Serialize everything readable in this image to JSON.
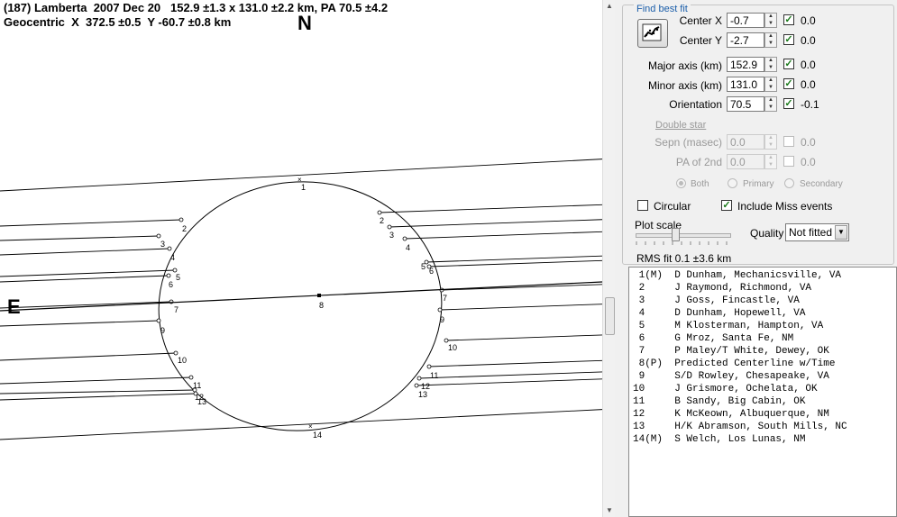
{
  "header": {
    "line1": "(187) Lamberta  2007 Dec 20   152.9 ±1.3 x 131.0 ±2.2 km, PA 70.5 ±4.2",
    "line2": "Geocentric  X  372.5 ±0.5  Y -60.7 ±0.8 km"
  },
  "compass": {
    "north": "N",
    "east": "E"
  },
  "chords": [
    {
      "label": "1"
    },
    {
      "label": "2"
    },
    {
      "label": "3"
    },
    {
      "label": "4"
    },
    {
      "label": "5"
    },
    {
      "label": "6"
    },
    {
      "label": "7"
    },
    {
      "label": "8"
    },
    {
      "label": "9"
    },
    {
      "label": "10"
    },
    {
      "label": "11"
    },
    {
      "label": "12"
    },
    {
      "label": "13"
    },
    {
      "label": "14"
    }
  ],
  "panel": {
    "group_title": "Find best fit",
    "fit_button_icon": "chart-fit-icon",
    "params": [
      {
        "label": "Center X",
        "value": "-0.7",
        "checked": true,
        "result": "0.0"
      },
      {
        "label": "Center Y",
        "value": "-2.7",
        "checked": true,
        "result": "0.0"
      },
      {
        "label": "Major axis (km)",
        "value": "152.9",
        "checked": true,
        "result": "0.0"
      },
      {
        "label": "Minor axis (km)",
        "value": "131.0",
        "checked": true,
        "result": "0.0"
      },
      {
        "label": "Orientation",
        "value": "70.5",
        "checked": true,
        "result": "-0.1"
      }
    ],
    "double_star": "Double star",
    "double_params": [
      {
        "label": "Sepn (masec)",
        "value": "0.0",
        "checked": false,
        "result": "0.0"
      },
      {
        "label": "PA of 2nd",
        "value": "0.0",
        "checked": false,
        "result": "0.0"
      }
    ],
    "radios": [
      "Both",
      "Primary",
      "Secondary"
    ],
    "circular": {
      "label": "Circular",
      "checked": false
    },
    "include_miss": {
      "label": "Include Miss events",
      "checked": true
    },
    "plot_scale": "Plot scale",
    "quality_label": "Quality",
    "quality_value": "Not fitted",
    "rms": "RMS fit 0.1 ±3.6 km"
  },
  "observers": [
    " 1(M)  D Dunham, Mechanicsville, VA",
    " 2     J Raymond, Richmond, VA",
    " 3     J Goss, Fincastle, VA",
    " 4     D Dunham, Hopewell, VA",
    " 5     M Klosterman, Hampton, VA",
    " 6     G Mroz, Santa Fe, NM",
    " 7     P Maley/T White, Dewey, OK",
    " 8(P)  Predicted Centerline w/Time",
    " 9     S/D Rowley, Chesapeake, VA",
    "10     J Grismore, Ochelata, OK",
    "11     B Sandy, Big Cabin, OK",
    "12     K McKeown, Albuquerque, NM",
    "13     H/K Abramson, South Mills, NC",
    "14(M)  S Welch, Los Lunas, NM"
  ]
}
